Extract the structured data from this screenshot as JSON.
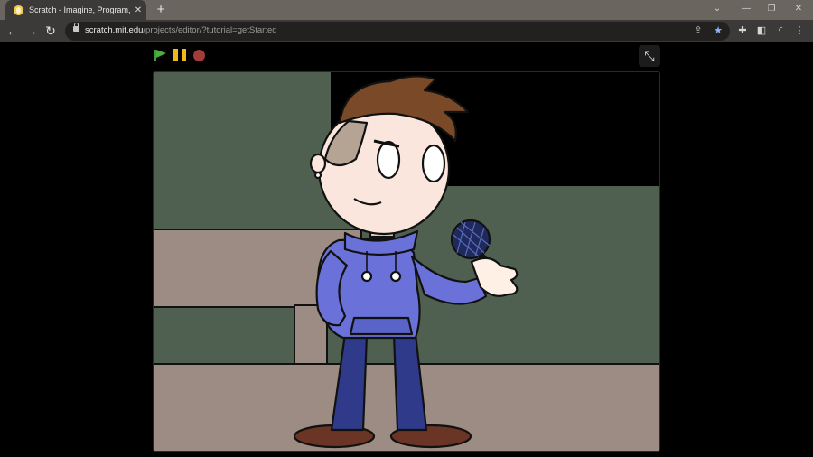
{
  "browser": {
    "tab": {
      "title": "Scratch - Imagine, Program, Share",
      "close_icon": "close-icon"
    },
    "new_tab_label": "+",
    "window_controls": [
      "chevron-down-icon",
      "minimize-icon",
      "restore-icon",
      "close-icon"
    ],
    "address": {
      "host": "scratch.mit.edu",
      "path": "/projects/editor/?tutorial=getStarted"
    },
    "nav": [
      "back-arrow-icon",
      "forward-arrow-icon",
      "reload-icon"
    ]
  },
  "player": {
    "controls": [
      "green-flag-icon",
      "pause-icon",
      "stop-icon"
    ],
    "fullscreen_icon": "exit-fullscreen-icon"
  },
  "colors": {
    "chrome_frame": "#6b6560",
    "toolbar": "#3c3a38",
    "stage_wall": "#4f5f50",
    "stage_floor": "#9c8c83",
    "hoodie": "#6a72d9",
    "hair": "#7a4a28"
  }
}
